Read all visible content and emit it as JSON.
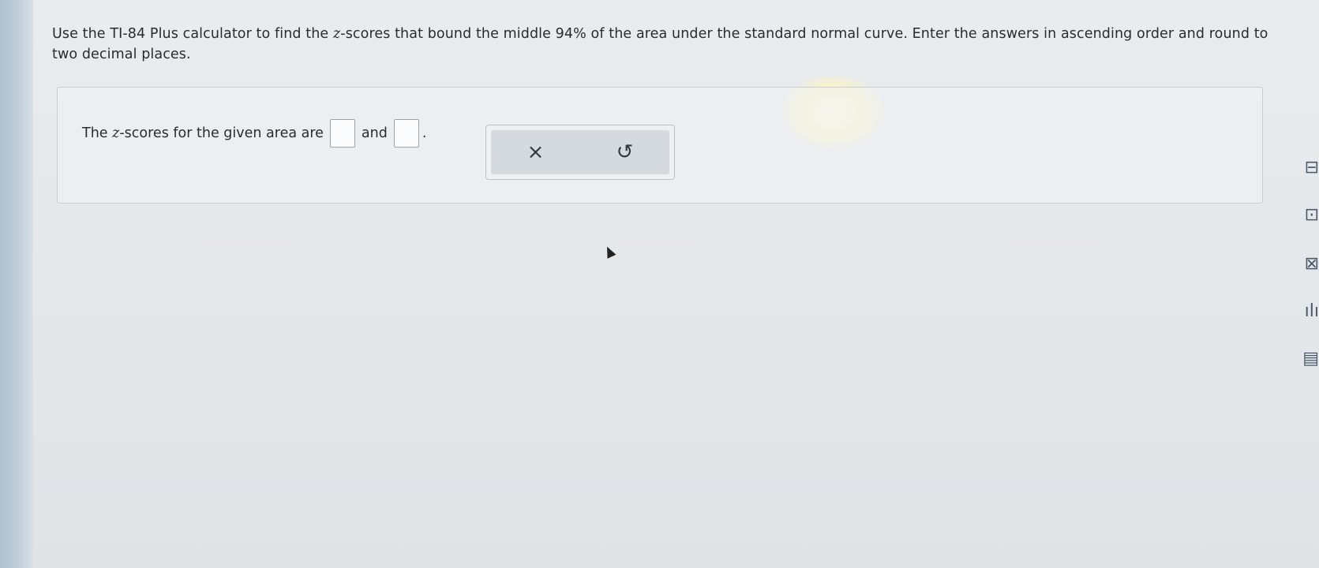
{
  "question": {
    "part1": "Use the TI-84 Plus calculator to find the ",
    "var": "z",
    "part2": "-scores that bound the middle 94% of the area under the standard normal curve. Enter the answers in ascending order and round to two decimal places."
  },
  "answer": {
    "prefix": "The ",
    "var": "z",
    "middle": "-scores for the given area are",
    "conj": "and",
    "suffix": "."
  },
  "tools": {
    "clear_glyph": "×",
    "undo_glyph": "↺"
  },
  "side": {
    "icons": [
      "⊟",
      "⊡",
      "⊠",
      "ılı",
      "▤"
    ]
  }
}
